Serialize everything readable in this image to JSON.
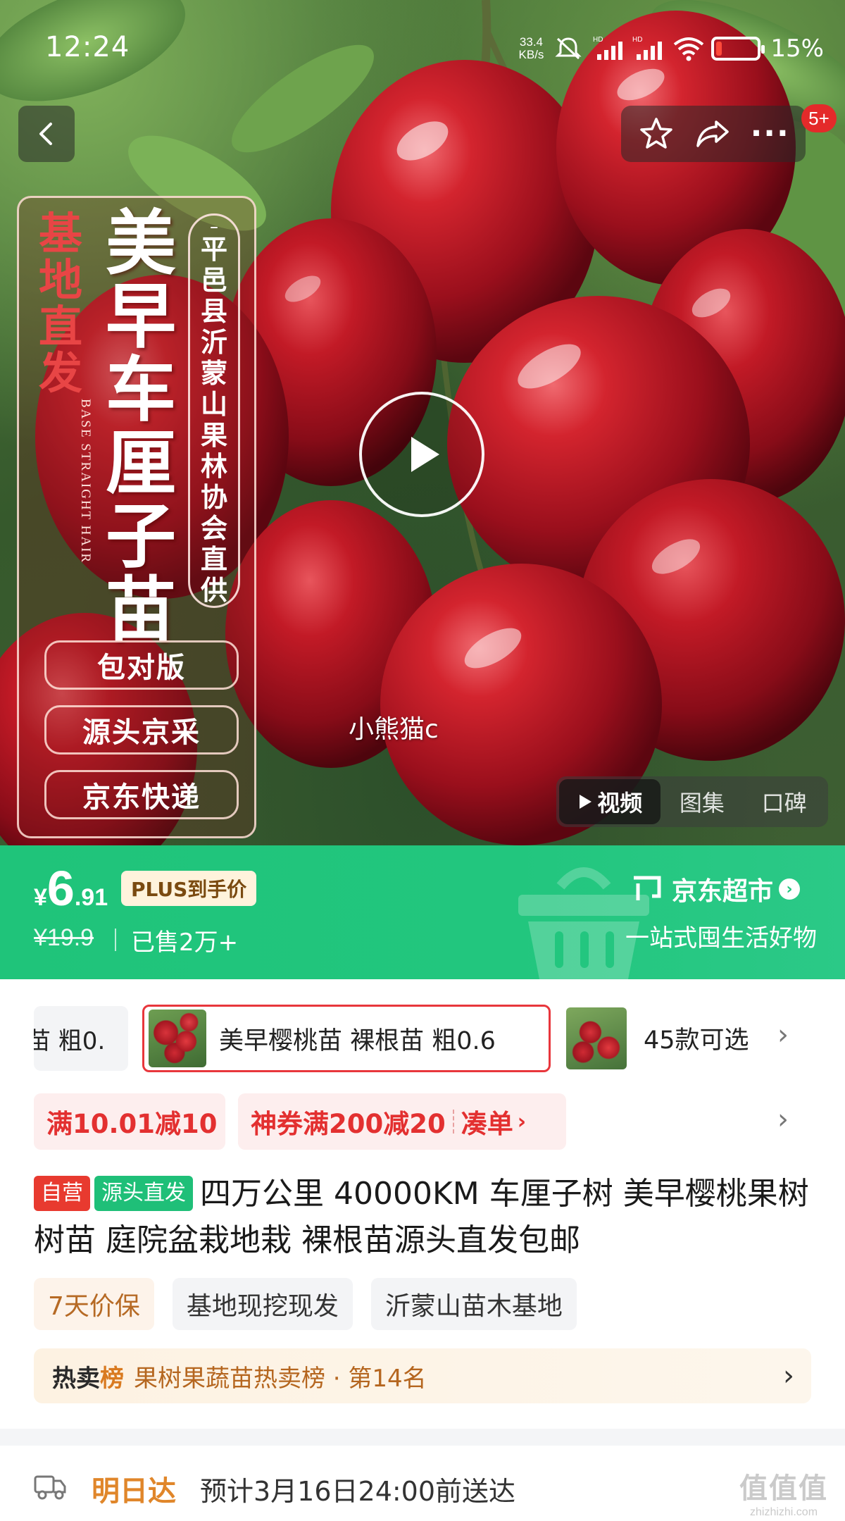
{
  "status_bar": {
    "time": "12:24",
    "net_speed_value": "33.4",
    "net_speed_unit": "KB/s",
    "battery_percent": "15%",
    "battery_level": 0.15,
    "icons": [
      "mute-icon",
      "signal-hd-icon",
      "signal-hd-icon",
      "wifi-icon",
      "battery-icon"
    ]
  },
  "nav": {
    "cart_badge": "5+",
    "icons": [
      "back-icon",
      "star-icon",
      "share-icon",
      "more-icon"
    ]
  },
  "hero": {
    "base_label": "基地直发",
    "base_label_en": "BASE STRAIGHT HAIR",
    "product_title": "美早车厘子苗",
    "origin_label": "平邑县沂蒙山果林协会直供",
    "tags": [
      "包对版",
      "源头京采",
      "京东快递"
    ],
    "user_watermark": "小熊猫c",
    "media_tabs": [
      {
        "label": "视频",
        "active": true
      },
      {
        "label": "图集",
        "active": false
      },
      {
        "label": "口碑",
        "active": false
      }
    ]
  },
  "price": {
    "currency": "¥",
    "current_int": "6",
    "current_dec": ".91",
    "plus_tag": "PLUS到手价",
    "original": "¥19.9",
    "sold": "已售2万+",
    "store_name": "京东超市",
    "store_slogan": "一站式囤生活好物",
    "banner_color": "#22c67e"
  },
  "sku": {
    "prev_label": "苗 粗0.",
    "selected_label": "美早樱桃苗  裸根苗  粗0.6",
    "more_count": "45款可选"
  },
  "coupons": {
    "c1": "满10.01减10",
    "c2": "神券满200减20",
    "c2_action": "凑单"
  },
  "product": {
    "tag_self": "自营",
    "tag_source": "源头直发",
    "title": "四万公里 40000KM 车厘子树 美早樱桃果树树苗 庭院盆栽地栽 裸根苗源头直发包邮"
  },
  "services": [
    "7天价保",
    "基地现挖现发",
    "沂蒙山苗木基地"
  ],
  "rank": {
    "hot_a": "热卖",
    "hot_b": "榜",
    "text": "果树果蔬苗热卖榜 · 第14名"
  },
  "delivery": {
    "label": "明日达",
    "text": "预计3月16日24:00前送达"
  },
  "watermark_site": {
    "big": "值值值",
    "small": "zhizhizhi.com"
  }
}
